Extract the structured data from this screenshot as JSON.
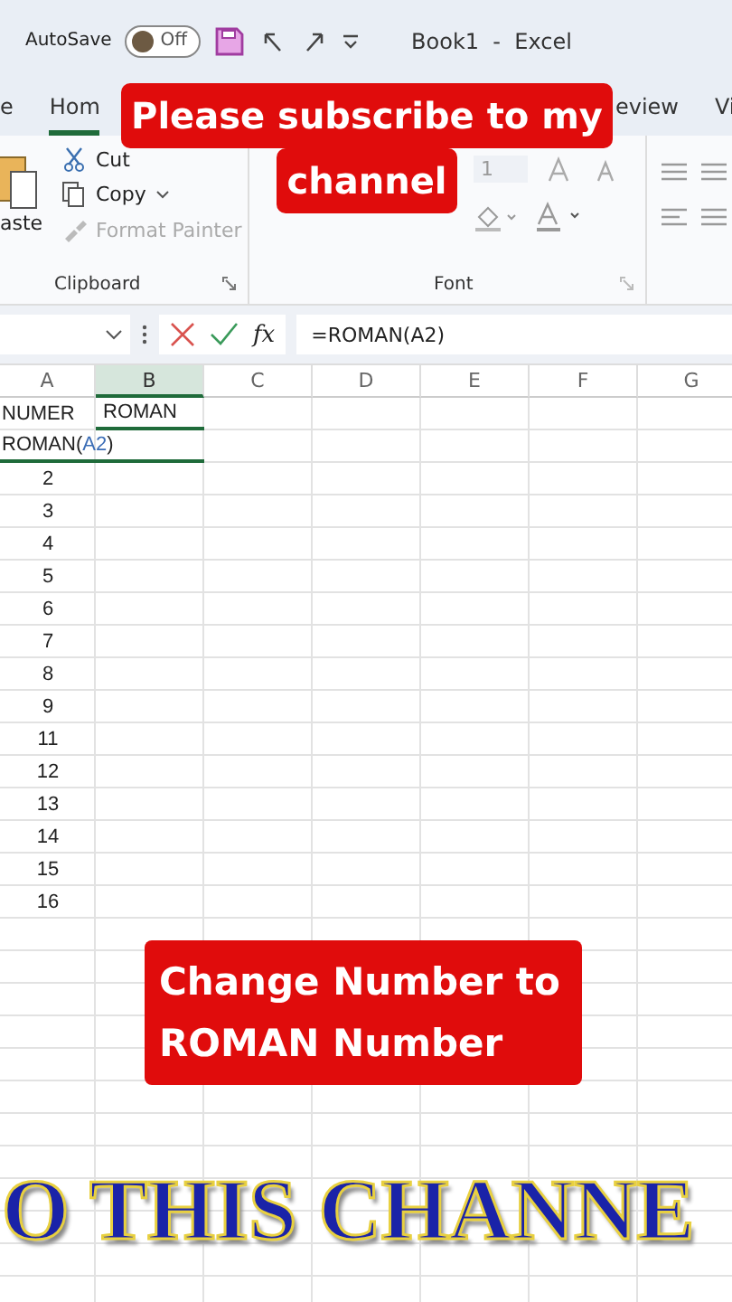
{
  "title_bar": {
    "autosave_label": "AutoSave",
    "autosave": {
      "on": false,
      "label": "Off"
    },
    "title": "Book1  -  Excel"
  },
  "ribbon_tabs": [
    {
      "label": "e",
      "selected": false
    },
    {
      "label": "Hom",
      "selected": true
    },
    {
      "label": "eview",
      "selected": false
    },
    {
      "label": "Vi",
      "selected": false
    }
  ],
  "ribbon": {
    "clipboard": {
      "paste": "aste",
      "cut": "Cut",
      "copy": "Copy",
      "format_painter": {
        "label": "Format Painter",
        "disabled": true
      },
      "group_label": "Clipboard"
    },
    "font": {
      "size": "1",
      "group_label": "Font"
    }
  },
  "formula_bar": {
    "function_button": "fx",
    "formula": "=ROMAN(A2)"
  },
  "sheet": {
    "columns": [
      {
        "label": "A",
        "selected": false
      },
      {
        "label": "B",
        "selected": true
      },
      {
        "label": "C",
        "selected": false
      },
      {
        "label": "D",
        "selected": false
      },
      {
        "label": "E",
        "selected": false
      },
      {
        "label": "F",
        "selected": false
      },
      {
        "label": "G",
        "selected": false
      }
    ],
    "rows": [
      {
        "kind": "header",
        "cells": [
          "NUMER",
          "ROMAN"
        ]
      },
      {
        "kind": "editing",
        "parts": [
          {
            "text": "ROMAN(",
            "kind": "plain"
          },
          {
            "text": "A2",
            "kind": "ref"
          },
          {
            "text": ")",
            "kind": "plain"
          }
        ]
      },
      {
        "kind": "number",
        "cells": [
          "2"
        ]
      },
      {
        "kind": "number",
        "cells": [
          "3"
        ]
      },
      {
        "kind": "number",
        "cells": [
          "4"
        ]
      },
      {
        "kind": "number",
        "cells": [
          "5"
        ]
      },
      {
        "kind": "number",
        "cells": [
          "6"
        ]
      },
      {
        "kind": "number",
        "cells": [
          "7"
        ]
      },
      {
        "kind": "number",
        "cells": [
          "8"
        ]
      },
      {
        "kind": "number",
        "cells": [
          "9"
        ]
      },
      {
        "kind": "number",
        "cells": [
          "11"
        ]
      },
      {
        "kind": "number",
        "cells": [
          "12"
        ]
      },
      {
        "kind": "number",
        "cells": [
          "13"
        ]
      },
      {
        "kind": "number",
        "cells": [
          "14"
        ]
      },
      {
        "kind": "number",
        "cells": [
          "15"
        ]
      },
      {
        "kind": "number",
        "cells": [
          "16"
        ]
      }
    ]
  },
  "overlays": [
    {
      "kind": "banner",
      "lines": [
        "Please subscribe to my",
        "channel"
      ]
    },
    {
      "kind": "caption",
      "text": "Change Number to ROMAN Number"
    },
    {
      "kind": "headline",
      "text": "O THIS CHANNE"
    }
  ]
}
